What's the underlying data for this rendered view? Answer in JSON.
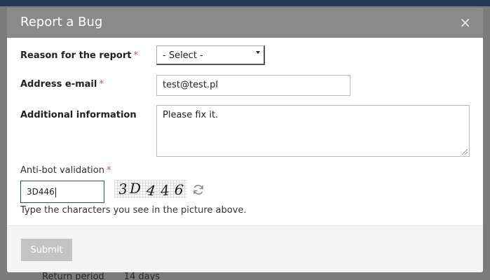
{
  "background": {
    "nav_items": [
      "...",
      "...",
      "...",
      "...",
      "...",
      "...",
      "..."
    ],
    "return_label": "Return period",
    "return_value": "14 days"
  },
  "modal": {
    "title": "Report a Bug",
    "close_symbol": "×"
  },
  "form": {
    "reason": {
      "label": "Reason for the report",
      "required_mark": "*",
      "selected": "- Select -"
    },
    "email": {
      "label": "Address e-mail",
      "required_mark": "*",
      "value": "test@test.pl"
    },
    "info": {
      "label": "Additional information",
      "value": "Please fix it."
    },
    "antibot": {
      "label": "Anti-bot validation",
      "required_mark": "*",
      "value": "3D446",
      "captcha_chars": [
        "3",
        "D",
        "4",
        "4",
        "6"
      ],
      "help": "Type the characters you see in the picture above."
    },
    "submit_label": "Submit"
  },
  "icons": {
    "close": "close-icon",
    "refresh": "refresh-icon",
    "select_arrow": "chevron-down-icon"
  },
  "colors": {
    "header": "#8a8a8a",
    "required": "#d9534f",
    "submit_disabled": "#c4c4c4"
  }
}
